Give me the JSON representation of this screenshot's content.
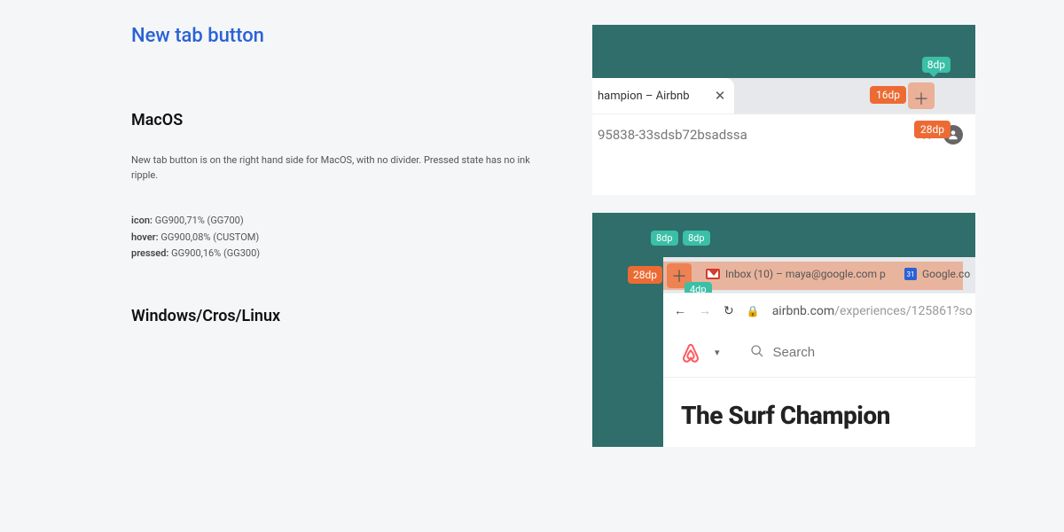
{
  "title": "New tab button",
  "macos": {
    "heading": "MacOS",
    "description": "New tab button is on the right hand side for MacOS, with no divider. Pressed state has no ink ripple.",
    "specs": {
      "icon_label": "icon:",
      "icon_value": "GG900,71% (GG700)",
      "hover_label": "hover:",
      "hover_value": "GG900,08% (CUSTOM)",
      "pressed_label": "pressed:",
      "pressed_value": "GG900,16% (GG300)"
    },
    "mock": {
      "tab_title": "hampion – Airbnb",
      "url_fragment": "95838-33sdsb72bsadssa",
      "anno_8": "8dp",
      "anno_16": "16dp",
      "anno_28": "28dp"
    }
  },
  "win": {
    "heading": "Windows/Cros/Linux",
    "mock": {
      "anno_28": "28dp",
      "anno_8a": "8dp",
      "anno_8b": "8dp",
      "anno_4": "4dp",
      "tab1_label": "Inbox (10) – maya@google.com p",
      "cal_day": "31",
      "tab2_label": "Google.co",
      "url_host": "airbnb.com",
      "url_path": "/experiences/125861?so",
      "search_placeholder": "Search",
      "headline": "The Surf Champion"
    }
  }
}
